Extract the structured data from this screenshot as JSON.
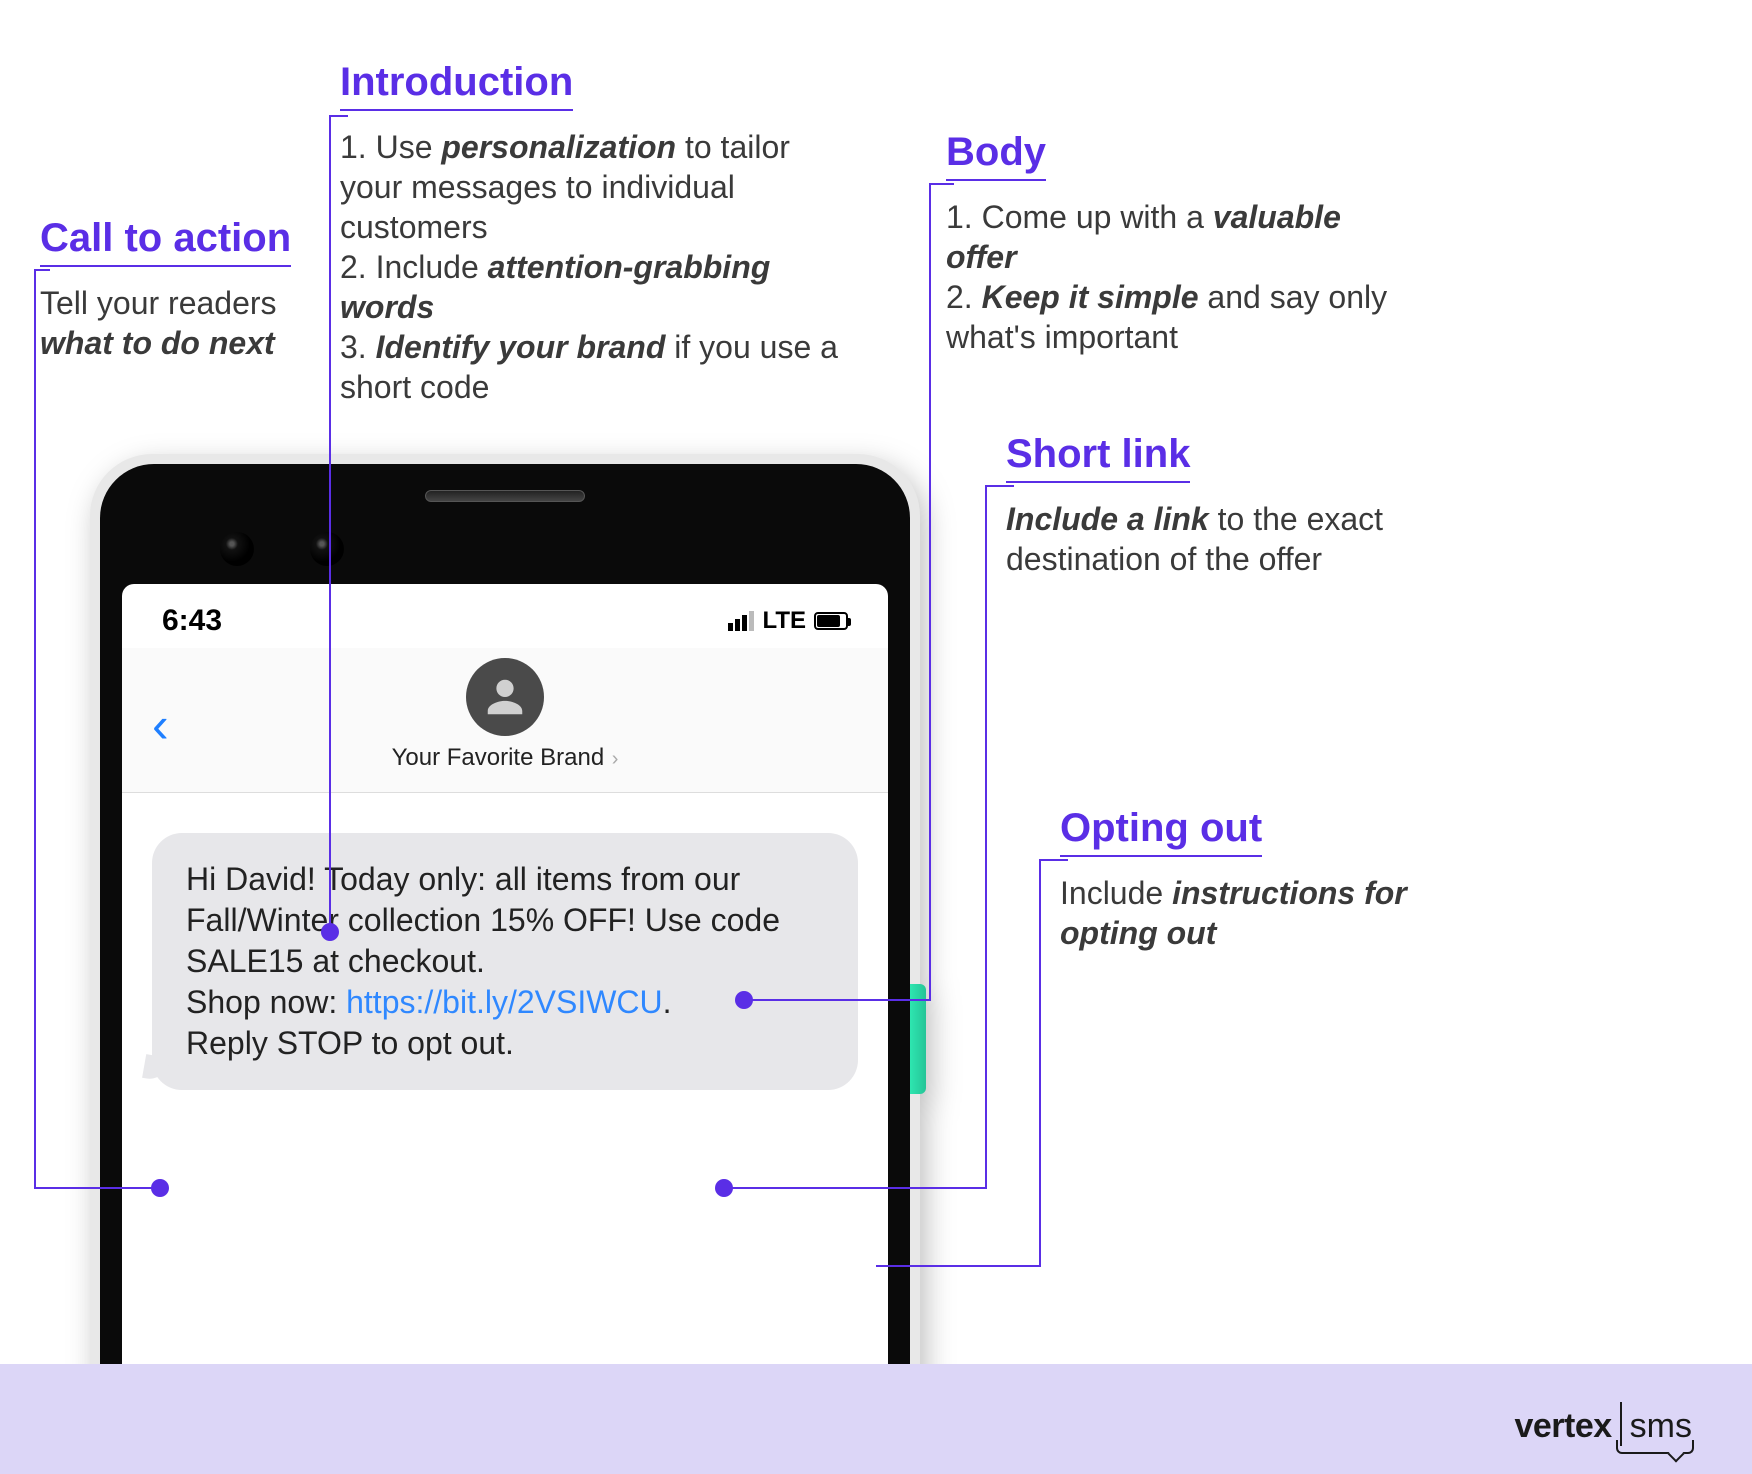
{
  "annotations": {
    "cta": {
      "title": "Call to action",
      "text_pre": "Tell your readers ",
      "text_bold": "what to do next"
    },
    "intro": {
      "title": "Introduction",
      "line1_pre": "1. Use ",
      "line1_bold": "personalization",
      "line1_post": " to tailor your messages to individual customers",
      "line2_pre": "2. Include ",
      "line2_bold": "attention-grabbing words",
      "line3_pre": "3. ",
      "line3_bold": "Identify your brand",
      "line3_post": " if you use a short code"
    },
    "body": {
      "title": "Body",
      "line1_pre": "1. Come up with a ",
      "line1_bold": "valuable offer",
      "line2_pre": "2. ",
      "line2_bold": "Keep it simple",
      "line2_post": " and say only what's important"
    },
    "shortlink": {
      "title": "Short link",
      "bold": "Include a link",
      "post": " to the exact destination of the offer"
    },
    "optout": {
      "title": "Opting out",
      "pre": "Include ",
      "bold": "instructions for opting out"
    }
  },
  "phone": {
    "time": "6:43",
    "network": "LTE",
    "sender_name": "Your Favorite Brand",
    "message": {
      "line1": "Hi David! Today only: all items from our Fall/Winter collection 15% OFF! Use code SALE15 at checkout.",
      "cta_label": "Shop now: ",
      "link": "https://bit.ly/2VSIWCU",
      "link_suffix": ".",
      "optout": "Reply STOP to opt out."
    }
  },
  "brand": {
    "left": "vertex",
    "right": "sms"
  }
}
